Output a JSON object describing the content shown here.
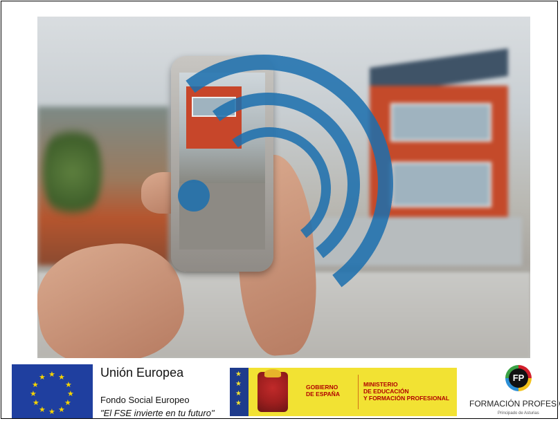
{
  "photo": {
    "description_icon": "house-smartphone-photo"
  },
  "logos": {
    "eu": {
      "title": "Unión Europea",
      "fund": "Fondo Social Europeo",
      "motto": "\"El FSE invierte en tu futuro\""
    },
    "gov": {
      "left_line1": "GOBIERNO",
      "left_line2": "DE ESPAÑA",
      "right_line1": "MINISTERIO",
      "right_line2": "DE EDUCACIÓN",
      "right_line3": "Y FORMACIÓN PROFESIONAL"
    },
    "fp": {
      "badge": "FP",
      "title": "FORMACIÓN PROFESIONA",
      "subtitle": "Principado de Asturias"
    }
  },
  "colors": {
    "eu_blue": "#1f3f9f",
    "eu_star": "#f6d400",
    "gov_yellow": "#f2e233",
    "gov_red": "#b00000",
    "wifi_blue": "#1b6fae"
  }
}
